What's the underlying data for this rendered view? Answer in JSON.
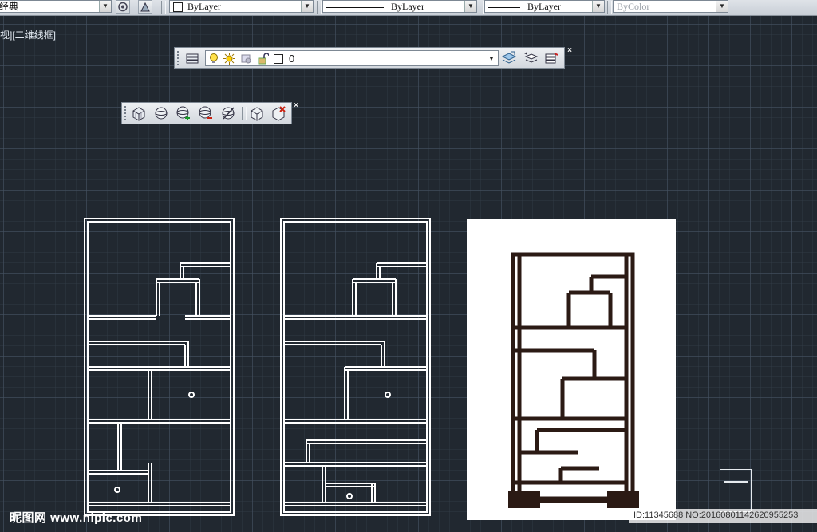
{
  "toolbar_top": {
    "workspace": "经典",
    "layer_value": "ByLayer",
    "linetype_value": "ByLayer",
    "lineweight_value": "ByLayer",
    "plotstyle_value": "ByColor"
  },
  "viewport_label": "视][二维线框]",
  "layers_toolbar": {
    "current_layer": "0",
    "icons": [
      "layer-manager-icon",
      "lightbulb-icon",
      "sun-icon",
      "freeze-viewport-icon",
      "unlock-icon",
      "color-swatch-icon",
      "make-current-icon",
      "layer-previous-icon",
      "layer-state-icon"
    ]
  },
  "view_toolbar": {
    "icons": [
      "3d-grid-icon",
      "sphere-icon",
      "sphere-add-icon",
      "sphere-subtract-icon",
      "sphere-slash-icon",
      "cube-icon",
      "cube-delete-icon"
    ]
  },
  "watermark": {
    "site": "昵图网 www.nipic.com",
    "id_text": "ID:11345688 NO:20160801142620955253"
  }
}
